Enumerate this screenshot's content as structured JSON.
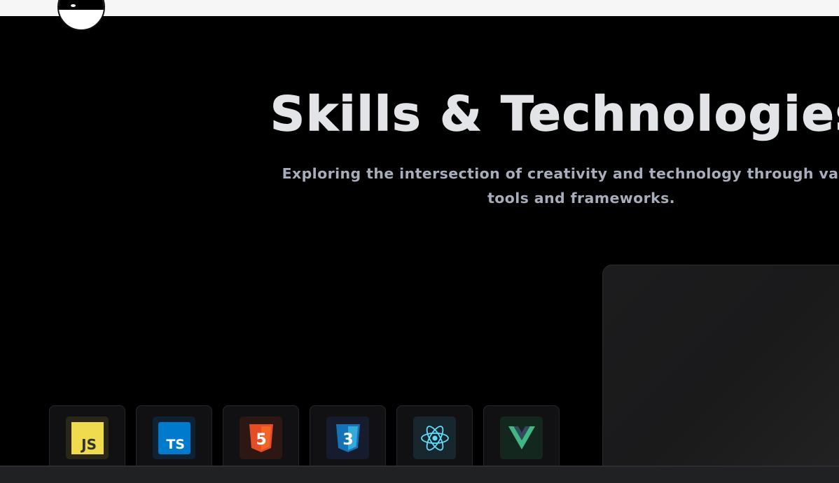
{
  "header": {
    "logo_icon": "avatar-logo-icon",
    "background": "#f6f6f6"
  },
  "hero": {
    "title": "Skills & Technologies",
    "subtitle": "Exploring the intersection of creativity and technology through various tools and frameworks."
  },
  "skills": [
    {
      "name": "JavaScript",
      "icon": "javascript-icon",
      "label": "JS",
      "color": "#f0db4f",
      "bg": "#2a2719"
    },
    {
      "name": "TypeScript",
      "icon": "typescript-icon",
      "label": "TS",
      "color": "#007acc",
      "bg": "#0f2233"
    },
    {
      "name": "HTML5",
      "icon": "html5-icon",
      "label": "5",
      "color": "#e44d26",
      "bg": "#2d1712"
    },
    {
      "name": "CSS3",
      "icon": "css3-icon",
      "label": "3",
      "color": "#1572b6",
      "bg": "#161b2e"
    },
    {
      "name": "React",
      "icon": "react-icon",
      "label": "",
      "color": "#61dafb",
      "bg": "#18262e"
    },
    {
      "name": "Vue",
      "icon": "vue-icon",
      "label": "",
      "color": "#41b883",
      "bg": "#13271f"
    }
  ],
  "colors": {
    "page_bg": "#000000",
    "title": "#e3e4e8",
    "subtitle": "#a7adba",
    "card": "#1c1c1e",
    "tile": "#111114"
  }
}
